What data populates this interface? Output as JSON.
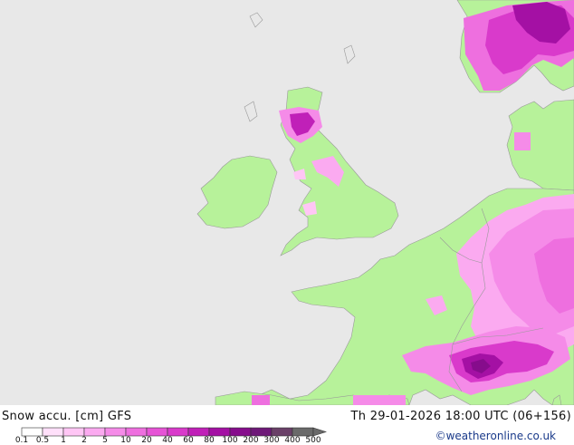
{
  "map": {
    "sea_color": "#e8e8e8",
    "land_color": "#b7f29a",
    "border_color": "#999999"
  },
  "footer": {
    "product": "Snow accu. [cm] GFS",
    "valid_time": "Th 29-01-2026 18:00 UTC (06+156)",
    "credit": "©weatheronline.co.uk"
  },
  "legend": {
    "labels": [
      "0.1",
      "0.5",
      "1",
      "2",
      "5",
      "10",
      "20",
      "40",
      "60",
      "80",
      "100",
      "200",
      "300",
      "400",
      "500"
    ],
    "colors": [
      "#ffffff",
      "#ffe0fa",
      "#ffc6f5",
      "#fbaaf0",
      "#f58be8",
      "#ee6fdf",
      "#e653d6",
      "#d93acb",
      "#c020b8",
      "#a410a4",
      "#860c8c",
      "#6e1878",
      "#6a4068",
      "#6a6a6a"
    ]
  },
  "icons": {
    "legend_arrow": "triangle-right-icon"
  }
}
